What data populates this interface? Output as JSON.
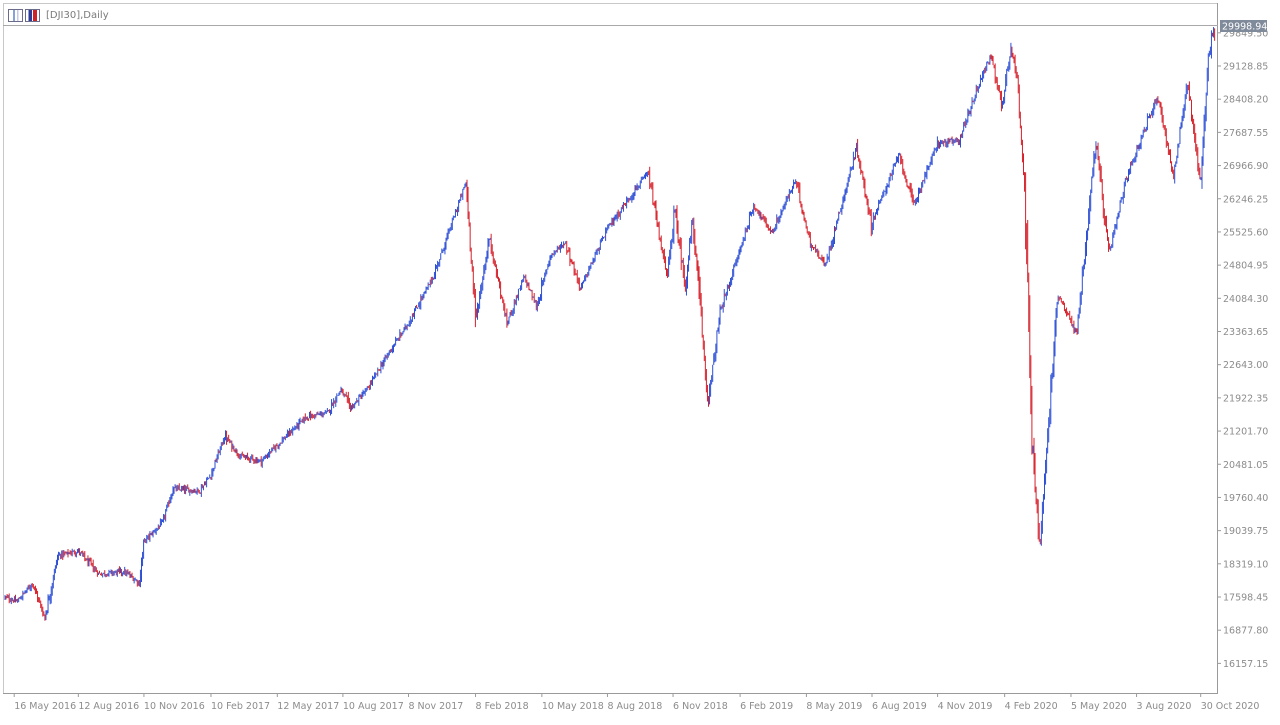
{
  "window": {
    "title": "[DJI30],Daily",
    "icons": [
      "chart-window-icon",
      "bar-chart-icon"
    ]
  },
  "chart_data": {
    "type": "candlestick",
    "symbol": "DJI30",
    "timeframe": "Daily",
    "current_price": "29998.94",
    "up_color": "#2d4fd6",
    "down_color": "#d6202a",
    "background": "#ffffff",
    "grid": false,
    "ylim": [
      15800,
      30200
    ],
    "y_ticks": [
      "29849.50",
      "29128.85",
      "28408.20",
      "27687.55",
      "26966.90",
      "26246.25",
      "25525.60",
      "24804.95",
      "24084.30",
      "23363.65",
      "22643.00",
      "21922.35",
      "21201.70",
      "20481.05",
      "19760.40",
      "19039.75",
      "18319.10",
      "17598.45",
      "16877.80",
      "16157.15"
    ],
    "x_ticks": [
      "16 May 2016",
      "12 Aug 2016",
      "10 Nov 2016",
      "10 Feb 2017",
      "12 May 2017",
      "10 Aug 2017",
      "8 Nov 2017",
      "8 Feb 2018",
      "10 May 2018",
      "8 Aug 2018",
      "6 Nov 2018",
      "6 Feb 2019",
      "8 May 2019",
      "6 Aug 2019",
      "4 Nov 2019",
      "4 Feb 2020",
      "5 May 2020",
      "3 Aug 2020",
      "30 Oct 2020"
    ],
    "x_range": [
      "2016-05-02",
      "2020-11-20"
    ],
    "price_path": [
      [
        "2016-05-02",
        17600
      ],
      [
        "2016-05-20",
        17500
      ],
      [
        "2016-06-10",
        17900
      ],
      [
        "2016-06-27",
        17150
      ],
      [
        "2016-07-15",
        18500
      ],
      [
        "2016-08-12",
        18600
      ],
      [
        "2016-09-09",
        18100
      ],
      [
        "2016-10-14",
        18150
      ],
      [
        "2016-11-04",
        17900
      ],
      [
        "2016-11-10",
        18800
      ],
      [
        "2016-12-05",
        19200
      ],
      [
        "2016-12-20",
        19950
      ],
      [
        "2017-01-25",
        19900
      ],
      [
        "2017-02-10",
        20250
      ],
      [
        "2017-03-01",
        21100
      ],
      [
        "2017-03-22",
        20650
      ],
      [
        "2017-04-20",
        20550
      ],
      [
        "2017-05-12",
        20900
      ],
      [
        "2017-06-20",
        21500
      ],
      [
        "2017-07-20",
        21600
      ],
      [
        "2017-08-07",
        22100
      ],
      [
        "2017-08-21",
        21700
      ],
      [
        "2017-09-12",
        22100
      ],
      [
        "2017-10-12",
        22900
      ],
      [
        "2017-11-08",
        23550
      ],
      [
        "2017-12-12",
        24550
      ],
      [
        "2018-01-26",
        26600
      ],
      [
        "2018-02-05",
        24350
      ],
      [
        "2018-02-08",
        23600
      ],
      [
        "2018-02-27",
        25400
      ],
      [
        "2018-03-23",
        23550
      ],
      [
        "2018-04-16",
        24550
      ],
      [
        "2018-05-03",
        23900
      ],
      [
        "2018-05-21",
        25000
      ],
      [
        "2018-06-11",
        25300
      ],
      [
        "2018-07-02",
        24300
      ],
      [
        "2018-08-08",
        25600
      ],
      [
        "2018-09-20",
        26550
      ],
      [
        "2018-10-03",
        26800
      ],
      [
        "2018-10-29",
        24500
      ],
      [
        "2018-11-08",
        26000
      ],
      [
        "2018-11-23",
        24350
      ],
      [
        "2018-12-03",
        25800
      ],
      [
        "2018-12-24",
        21800
      ],
      [
        "2019-01-10",
        23800
      ],
      [
        "2019-02-25",
        26100
      ],
      [
        "2019-03-22",
        25500
      ],
      [
        "2019-04-23",
        26650
      ],
      [
        "2019-05-13",
        25300
      ],
      [
        "2019-06-03",
        24800
      ],
      [
        "2019-07-16",
        27350
      ],
      [
        "2019-08-05",
        25700
      ],
      [
        "2019-09-12",
        27200
      ],
      [
        "2019-10-02",
        26100
      ],
      [
        "2019-11-04",
        27450
      ],
      [
        "2019-12-03",
        27500
      ],
      [
        "2020-01-02",
        28850
      ],
      [
        "2020-01-17",
        29350
      ],
      [
        "2020-01-31",
        28250
      ],
      [
        "2020-02-12",
        29550
      ],
      [
        "2020-02-21",
        28900
      ],
      [
        "2020-03-02",
        26700
      ],
      [
        "2020-03-12",
        21200
      ],
      [
        "2020-03-23",
        18600
      ],
      [
        "2020-04-17",
        24200
      ],
      [
        "2020-05-13",
        23300
      ],
      [
        "2020-06-08",
        27500
      ],
      [
        "2020-06-26",
        25000
      ],
      [
        "2020-07-20",
        26700
      ],
      [
        "2020-08-31",
        28450
      ],
      [
        "2020-09-03",
        28350
      ],
      [
        "2020-09-23",
        26700
      ],
      [
        "2020-10-12",
        28800
      ],
      [
        "2020-10-30",
        26550
      ],
      [
        "2020-11-09",
        29200
      ],
      [
        "2020-11-16",
        29900
      ],
      [
        "2020-11-20",
        29600
      ]
    ]
  }
}
